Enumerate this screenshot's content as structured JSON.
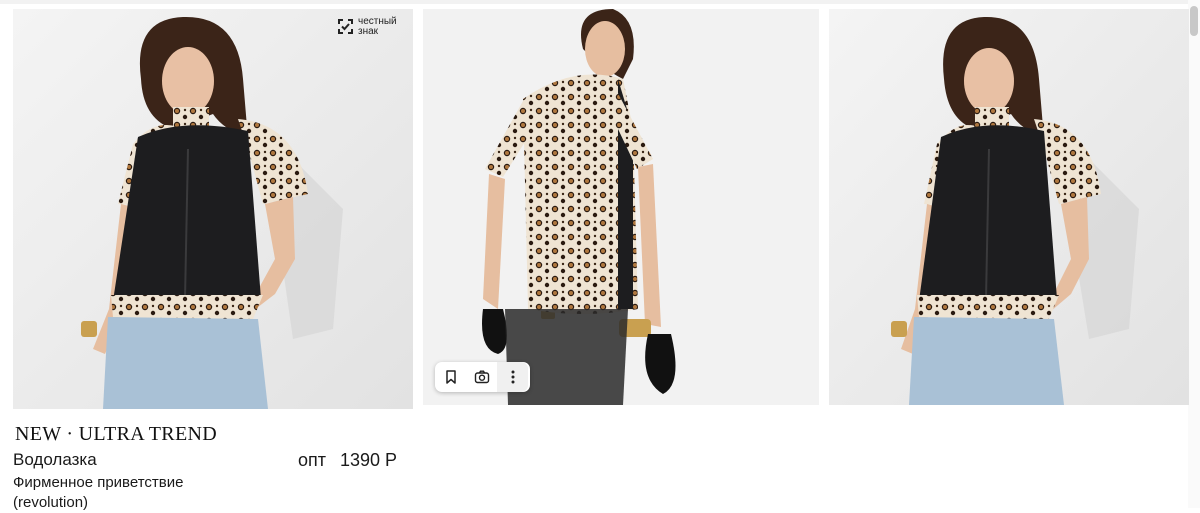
{
  "product": {
    "brand": "NEW · ULTRA TREND",
    "name": "Водолазка",
    "price_label": "опт",
    "price": "1390 Р",
    "description": "Фирменное приветствие (revolution)"
  },
  "badge": {
    "text": "честный знак",
    "icon": "honest-sign-icon"
  },
  "toolbar": {
    "icons": [
      "bookmark-icon",
      "camera-icon",
      "more-vertical-icon"
    ]
  },
  "photos": [
    {
      "view": "front"
    },
    {
      "view": "back"
    },
    {
      "view": "front"
    }
  ]
}
